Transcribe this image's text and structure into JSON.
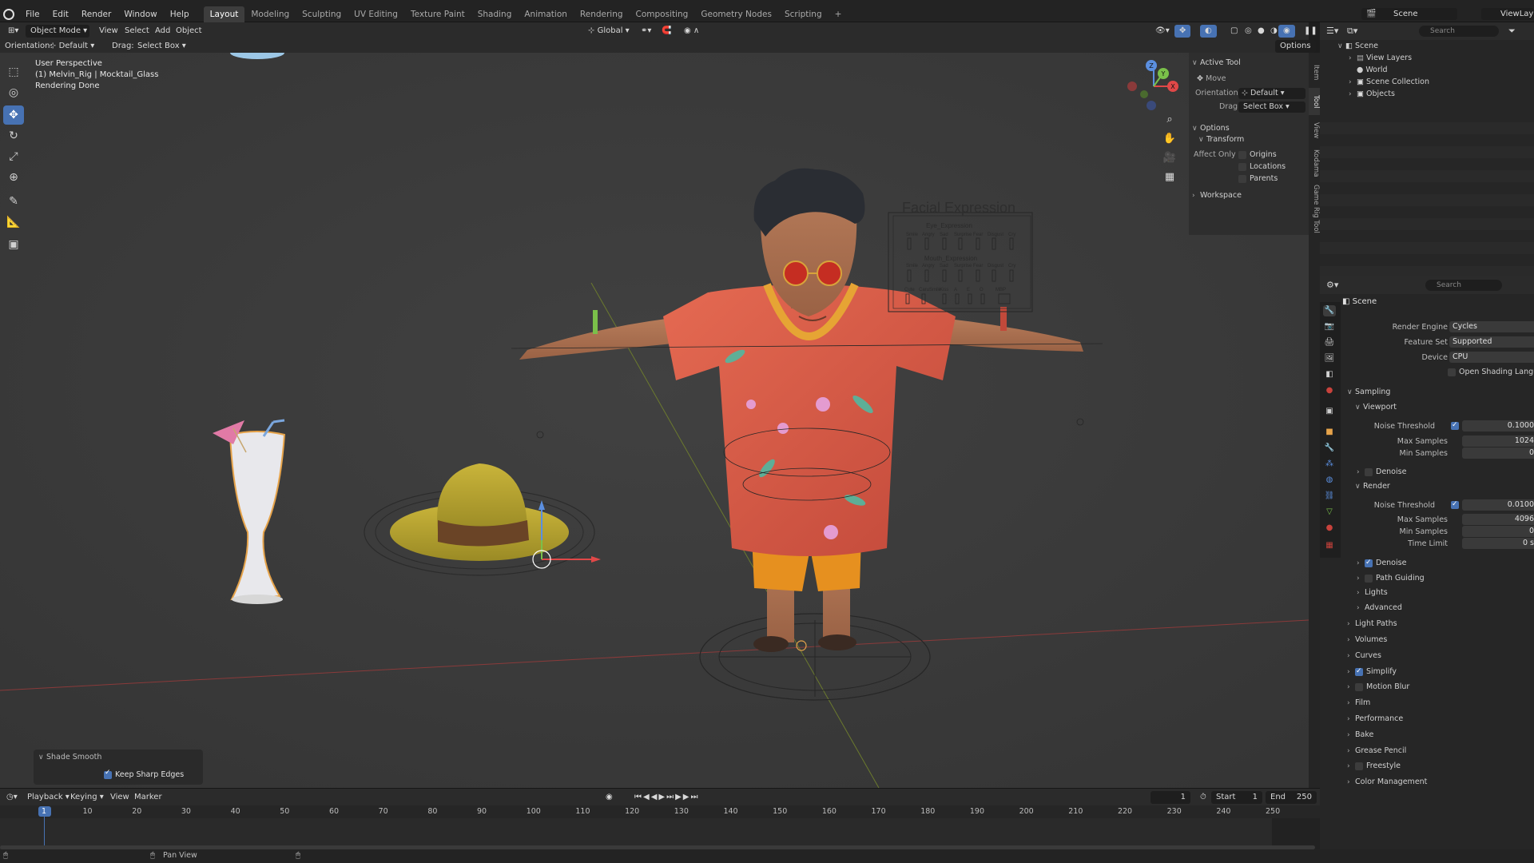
{
  "topbar": {
    "menus": [
      "File",
      "Edit",
      "Render",
      "Window",
      "Help"
    ],
    "workspaces": [
      "Layout",
      "Modeling",
      "Sculpting",
      "UV Editing",
      "Texture Paint",
      "Shading",
      "Animation",
      "Rendering",
      "Compositing",
      "Geometry Nodes",
      "Scripting"
    ],
    "add_tab": "+",
    "scene_label": "Scene",
    "viewlayer_label": "ViewLayer"
  },
  "header": {
    "mode": "Object Mode",
    "menus": [
      "View",
      "Select",
      "Add",
      "Object"
    ],
    "transform_orientation": "Global",
    "options_label": "Options"
  },
  "tool_settings": {
    "orientation_label": "Orientation:",
    "orientation_value": "Default",
    "drag_label": "Drag:",
    "drag_value": "Select Box"
  },
  "viewport": {
    "info_line1": "User Perspective",
    "info_line2": "(1) Melvin_Rig | Mocktail_Glass",
    "info_line3": "Rendering Done",
    "facial_title": "Facial Expression",
    "eye_title": "Eye_Expression",
    "mouth_title": "Mouth_Expression",
    "eye_labels": [
      "Smile",
      "Angry",
      "Sad",
      "Surprise",
      "Fear",
      "Disgust",
      "Cry"
    ],
    "mouth_labels": [
      "Smile",
      "Angry",
      "Sad",
      "Surprise",
      "Fear",
      "Disgust",
      "Cry"
    ],
    "phoneme_labels": [
      "Cute",
      "CaruSmile",
      "Kiss",
      "A",
      "E",
      "O",
      "MBP"
    ],
    "gizmo_z": "Z",
    "gizmo_y": "Y",
    "gizmo_x": "X"
  },
  "npanel": {
    "active_tool": "Active Tool",
    "move": "Move",
    "orientation_label": "Orientation",
    "orientation_value": "Default",
    "drag_label": "Drag:",
    "drag_value": "Select Box",
    "options": "Options",
    "transform": "Transform",
    "affect_only": "Affect Only",
    "origins": "Origins",
    "locations": "Locations",
    "parents": "Parents",
    "workspace": "Workspace",
    "tabs": [
      "Item",
      "Tool",
      "View",
      "Kodama",
      "Game Rig Tool"
    ]
  },
  "outliner": {
    "search_placeholder": "Search",
    "items": [
      "Scene",
      "View Layers",
      "World",
      "Scene Collection",
      "Objects"
    ]
  },
  "properties": {
    "search_placeholder": "Search",
    "scene": "Scene",
    "render_engine_label": "Render Engine",
    "render_engine": "Cycles",
    "feature_set_label": "Feature Set",
    "feature_set": "Supported",
    "device_label": "Device",
    "device": "CPU",
    "osl": "Open Shading Language",
    "sampling": "Sampling",
    "viewport": "Viewport",
    "noise_threshold_label": "Noise Threshold",
    "vp_noise_threshold": "0.1000",
    "max_samples_label": "Max Samples",
    "vp_max_samples": "1024",
    "min_samples_label": "Min Samples",
    "vp_min_samples": "0",
    "denoise": "Denoise",
    "render": "Render",
    "r_noise_threshold": "0.0100",
    "r_max_samples": "4096",
    "r_min_samples": "0",
    "time_limit_label": "Time Limit",
    "time_limit": "0 s",
    "path_guiding": "Path Guiding",
    "lights": "Lights",
    "advanced": "Advanced",
    "sections": [
      "Light Paths",
      "Volumes",
      "Curves",
      "Simplify",
      "Motion Blur",
      "Film",
      "Performance",
      "Bake",
      "Grease Pencil",
      "Freestyle",
      "Color Management"
    ]
  },
  "operator_panel": {
    "title": "Shade Smooth",
    "option": "Keep Sharp Edges"
  },
  "timeline": {
    "menus": [
      "Playback",
      "Keying",
      "View",
      "Marker"
    ],
    "current_frame": "1",
    "start_label": "Start",
    "start": "1",
    "end_label": "End",
    "end": "250",
    "ticks": [
      "1",
      "10",
      "20",
      "30",
      "40",
      "50",
      "60",
      "70",
      "80",
      "90",
      "100",
      "110",
      "120",
      "130",
      "140",
      "150",
      "160",
      "170",
      "180",
      "190",
      "200",
      "210",
      "220",
      "230",
      "240",
      "250"
    ]
  },
  "statusbar": {
    "pan_view": "Pan View"
  }
}
